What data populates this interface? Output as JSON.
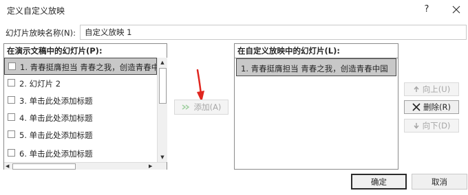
{
  "dialog": {
    "title": "定义自定义放映",
    "help": "?"
  },
  "name": {
    "label": "幻灯片放映名称(N):",
    "value": "自定义放映 1"
  },
  "left_panel": {
    "header": "在演示文稿中的幻灯片(P):",
    "items": [
      {
        "label": "1. 青春挺膺担当 青春之我，创造青春中国",
        "checked": false,
        "selected": true
      },
      {
        "label": "2. 幻灯片 2",
        "checked": false,
        "selected": false
      },
      {
        "label": "3. 单击此处添加标题",
        "checked": false,
        "selected": false
      },
      {
        "label": "4. 单击此处添加标题",
        "checked": false,
        "selected": false
      },
      {
        "label": "5. 单击此处添加标题",
        "checked": false,
        "selected": false
      },
      {
        "label": "6. 单击此处添加标题",
        "checked": false,
        "selected": false
      }
    ]
  },
  "add_button": {
    "label": "添加(A)",
    "enabled": false
  },
  "right_panel": {
    "header": "在自定义放映中的幻灯片(L):",
    "items": [
      {
        "label": "1. 青春挺膺担当 青春之我，创造青春中国",
        "selected": true
      }
    ]
  },
  "side_buttons": {
    "up": {
      "label": "向上(U)",
      "enabled": false
    },
    "delete": {
      "label": "删除(R)",
      "enabled": true
    },
    "down": {
      "label": "向下(D)",
      "enabled": false
    }
  },
  "footer": {
    "ok": "确定",
    "cancel": "取消"
  },
  "colors": {
    "annotation_arrow": "#e0261f",
    "selection": "#c8c8c8"
  }
}
